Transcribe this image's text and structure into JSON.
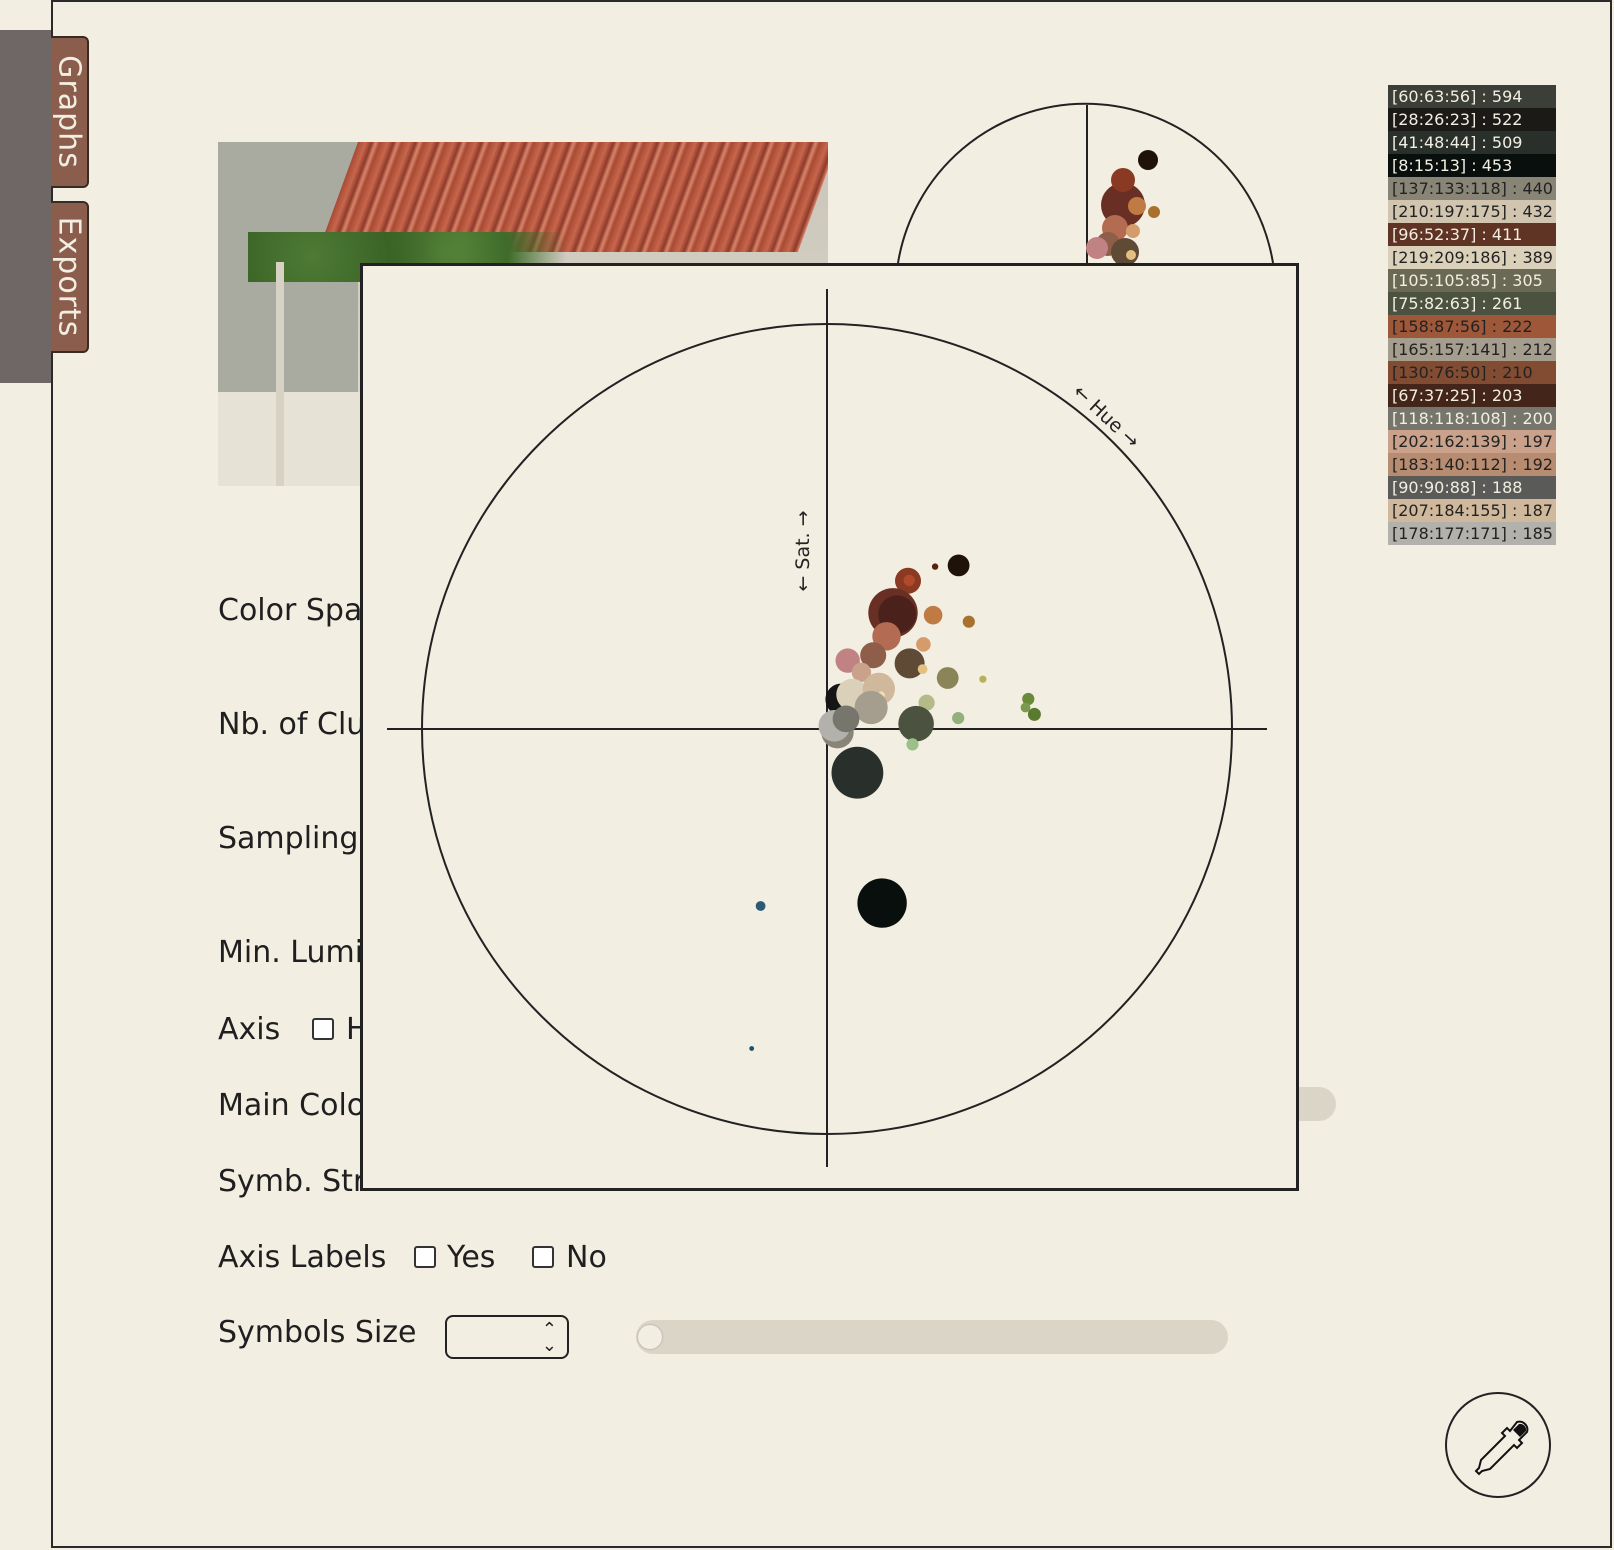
{
  "tabs": [
    {
      "label": "Graphs"
    },
    {
      "label": "Exports"
    }
  ],
  "form": {
    "color_space_label": "Color Spa",
    "nb_clusters_label": "Nb. of Clu",
    "sampling_label": "Sampling",
    "min_lumi_label": "Min. Lumi",
    "axis_label": "Axis",
    "axis_option": "H",
    "main_colors_label": "Main Colo",
    "symb_stroke_label": "Symb. Str",
    "axis_labels_label": "Axis Labels",
    "axis_labels_yes": "Yes",
    "axis_labels_no": "No",
    "symbols_size_label": "Symbols Size"
  },
  "legend": [
    {
      "text": "[60:63:56] : 594",
      "bg": "#3c3f38",
      "fg": "#f3eee2"
    },
    {
      "text": "[28:26:23] : 522",
      "bg": "#1c1a17",
      "fg": "#f3eee2"
    },
    {
      "text": "[41:48:44] : 509",
      "bg": "#29302c",
      "fg": "#f3eee2"
    },
    {
      "text": "[8:15:13] : 453",
      "bg": "#080f0d",
      "fg": "#f3eee2"
    },
    {
      "text": "[137:133:118] : 440",
      "bg": "#898576",
      "fg": "#222222"
    },
    {
      "text": "[210:197:175] : 432",
      "bg": "#d2c5af",
      "fg": "#222222"
    },
    {
      "text": "[96:52:37] : 411",
      "bg": "#603425",
      "fg": "#f3eee2"
    },
    {
      "text": "[219:209:186] : 389",
      "bg": "#dbd1ba",
      "fg": "#222222"
    },
    {
      "text": "[105:105:85] : 305",
      "bg": "#696955",
      "fg": "#f3eee2"
    },
    {
      "text": "[75:82:63] : 261",
      "bg": "#4b523f",
      "fg": "#f3eee2"
    },
    {
      "text": "[158:87:56] : 222",
      "bg": "#9e5738",
      "fg": "#222222"
    },
    {
      "text": "[165:157:141] : 212",
      "bg": "#a59d8d",
      "fg": "#222222"
    },
    {
      "text": "[130:76:50] : 210",
      "bg": "#824c32",
      "fg": "#222222"
    },
    {
      "text": "[67:37:25] : 203",
      "bg": "#432519",
      "fg": "#f3eee2"
    },
    {
      "text": "[118:118:108] : 200",
      "bg": "#76766c",
      "fg": "#f3eee2"
    },
    {
      "text": "[202:162:139] : 197",
      "bg": "#caa28b",
      "fg": "#222222"
    },
    {
      "text": "[183:140:112] : 192",
      "bg": "#b78c70",
      "fg": "#222222"
    },
    {
      "text": "[90:90:88] : 188",
      "bg": "#5a5a58",
      "fg": "#f3eee2"
    },
    {
      "text": "[207:184:155] : 187",
      "bg": "#cfb89b",
      "fg": "#222222"
    },
    {
      "text": "[178:177:171] : 185",
      "bg": "#b2b1ab",
      "fg": "#222222"
    }
  ],
  "chart_data": {
    "type": "scatter",
    "axis_labels": {
      "sat": "Sat.",
      "hue": "Hue"
    },
    "points": [
      {
        "x": 0.325,
        "y": -0.404,
        "r": 0.027,
        "color": "#1f1209"
      },
      {
        "x": 0.267,
        "y": -0.401,
        "r": 0.008,
        "color": "#5a2010"
      },
      {
        "x": 0.2,
        "y": -0.366,
        "r": 0.032,
        "color": "#8a3a22"
      },
      {
        "x": 0.203,
        "y": -0.367,
        "r": 0.014,
        "color": "#b04a2a"
      },
      {
        "x": 0.163,
        "y": -0.287,
        "r": 0.061,
        "color": "#6a2f24"
      },
      {
        "x": 0.173,
        "y": -0.283,
        "r": 0.047,
        "color": "#4a221b"
      },
      {
        "x": 0.262,
        "y": -0.281,
        "r": 0.023,
        "color": "#c07a44"
      },
      {
        "x": 0.35,
        "y": -0.265,
        "r": 0.015,
        "color": "#a8722e"
      },
      {
        "x": 0.147,
        "y": -0.229,
        "r": 0.035,
        "color": "#b36c52"
      },
      {
        "x": 0.238,
        "y": -0.209,
        "r": 0.018,
        "color": "#d49c6a"
      },
      {
        "x": 0.114,
        "y": -0.182,
        "r": 0.032,
        "color": "#8f5e4a"
      },
      {
        "x": 0.204,
        "y": -0.162,
        "r": 0.037,
        "color": "#5f4a36"
      },
      {
        "x": 0.236,
        "y": -0.148,
        "r": 0.012,
        "color": "#e4c080"
      },
      {
        "x": 0.051,
        "y": -0.169,
        "r": 0.03,
        "color": "#c08282"
      },
      {
        "x": 0.298,
        "y": -0.126,
        "r": 0.027,
        "color": "#8a8458"
      },
      {
        "x": 0.385,
        "y": -0.123,
        "r": 0.009,
        "color": "#b5b05a"
      },
      {
        "x": 0.085,
        "y": -0.14,
        "r": 0.024,
        "color": "#caa28b"
      },
      {
        "x": 0.035,
        "y": -0.073,
        "r": 0.039,
        "color": "#151515"
      },
      {
        "x": 0.062,
        "y": -0.085,
        "r": 0.039,
        "color": "#dbd1ba"
      },
      {
        "x": 0.128,
        "y": -0.099,
        "r": 0.04,
        "color": "#cfb89b"
      },
      {
        "x": 0.134,
        "y": -0.084,
        "r": 0.009,
        "color": "#f0ddb5"
      },
      {
        "x": 0.246,
        "y": -0.065,
        "r": 0.02,
        "color": "#b5bb88"
      },
      {
        "x": 0.497,
        "y": -0.074,
        "r": 0.015,
        "color": "#6a8a3a"
      },
      {
        "x": 0.49,
        "y": -0.053,
        "r": 0.012,
        "color": "#7a9a50"
      },
      {
        "x": 0.512,
        "y": -0.036,
        "r": 0.016,
        "color": "#5a7a30"
      },
      {
        "x": 0.109,
        "y": -0.053,
        "r": 0.041,
        "color": "#a59d8d"
      },
      {
        "x": 0.22,
        "y": -0.013,
        "r": 0.044,
        "color": "#4b523f"
      },
      {
        "x": 0.324,
        "y": -0.027,
        "r": 0.015,
        "color": "#94b07a"
      },
      {
        "x": 0.026,
        "y": 0.008,
        "r": 0.04,
        "color": "#898576"
      },
      {
        "x": 0.018,
        "y": -0.008,
        "r": 0.039,
        "color": "#b2b1ab"
      },
      {
        "x": 0.047,
        "y": -0.025,
        "r": 0.033,
        "color": "#76766c"
      },
      {
        "x": 0.211,
        "y": 0.038,
        "r": 0.015,
        "color": "#9cc08a"
      },
      {
        "x": 0.075,
        "y": 0.108,
        "r": 0.064,
        "color": "#29302c"
      },
      {
        "x": 0.136,
        "y": 0.43,
        "r": 0.061,
        "color": "#080f0d"
      },
      {
        "x": -0.164,
        "y": 0.437,
        "r": 0.012,
        "color": "#2a5a78"
      },
      {
        "x": -0.186,
        "y": 0.789,
        "r": 0.006,
        "color": "#1c4e6e"
      }
    ]
  }
}
